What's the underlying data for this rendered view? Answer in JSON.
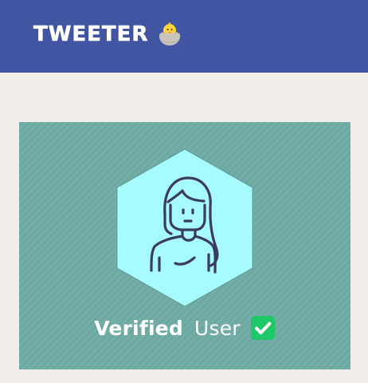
{
  "header": {
    "title": "TWEETER",
    "logo_icon": "hatching-chick-icon",
    "background_color": "#4155a3"
  },
  "card": {
    "background_color": "#6eaaa4",
    "hexagon_color": "#a5fbfd",
    "avatar_icon": "user-avatar-icon",
    "badge_strong": "Verified",
    "badge_light": "User",
    "check_icon": "checkmark-icon",
    "check_color": "#1fc96a"
  },
  "page": {
    "background_color": "#f2efeb"
  }
}
